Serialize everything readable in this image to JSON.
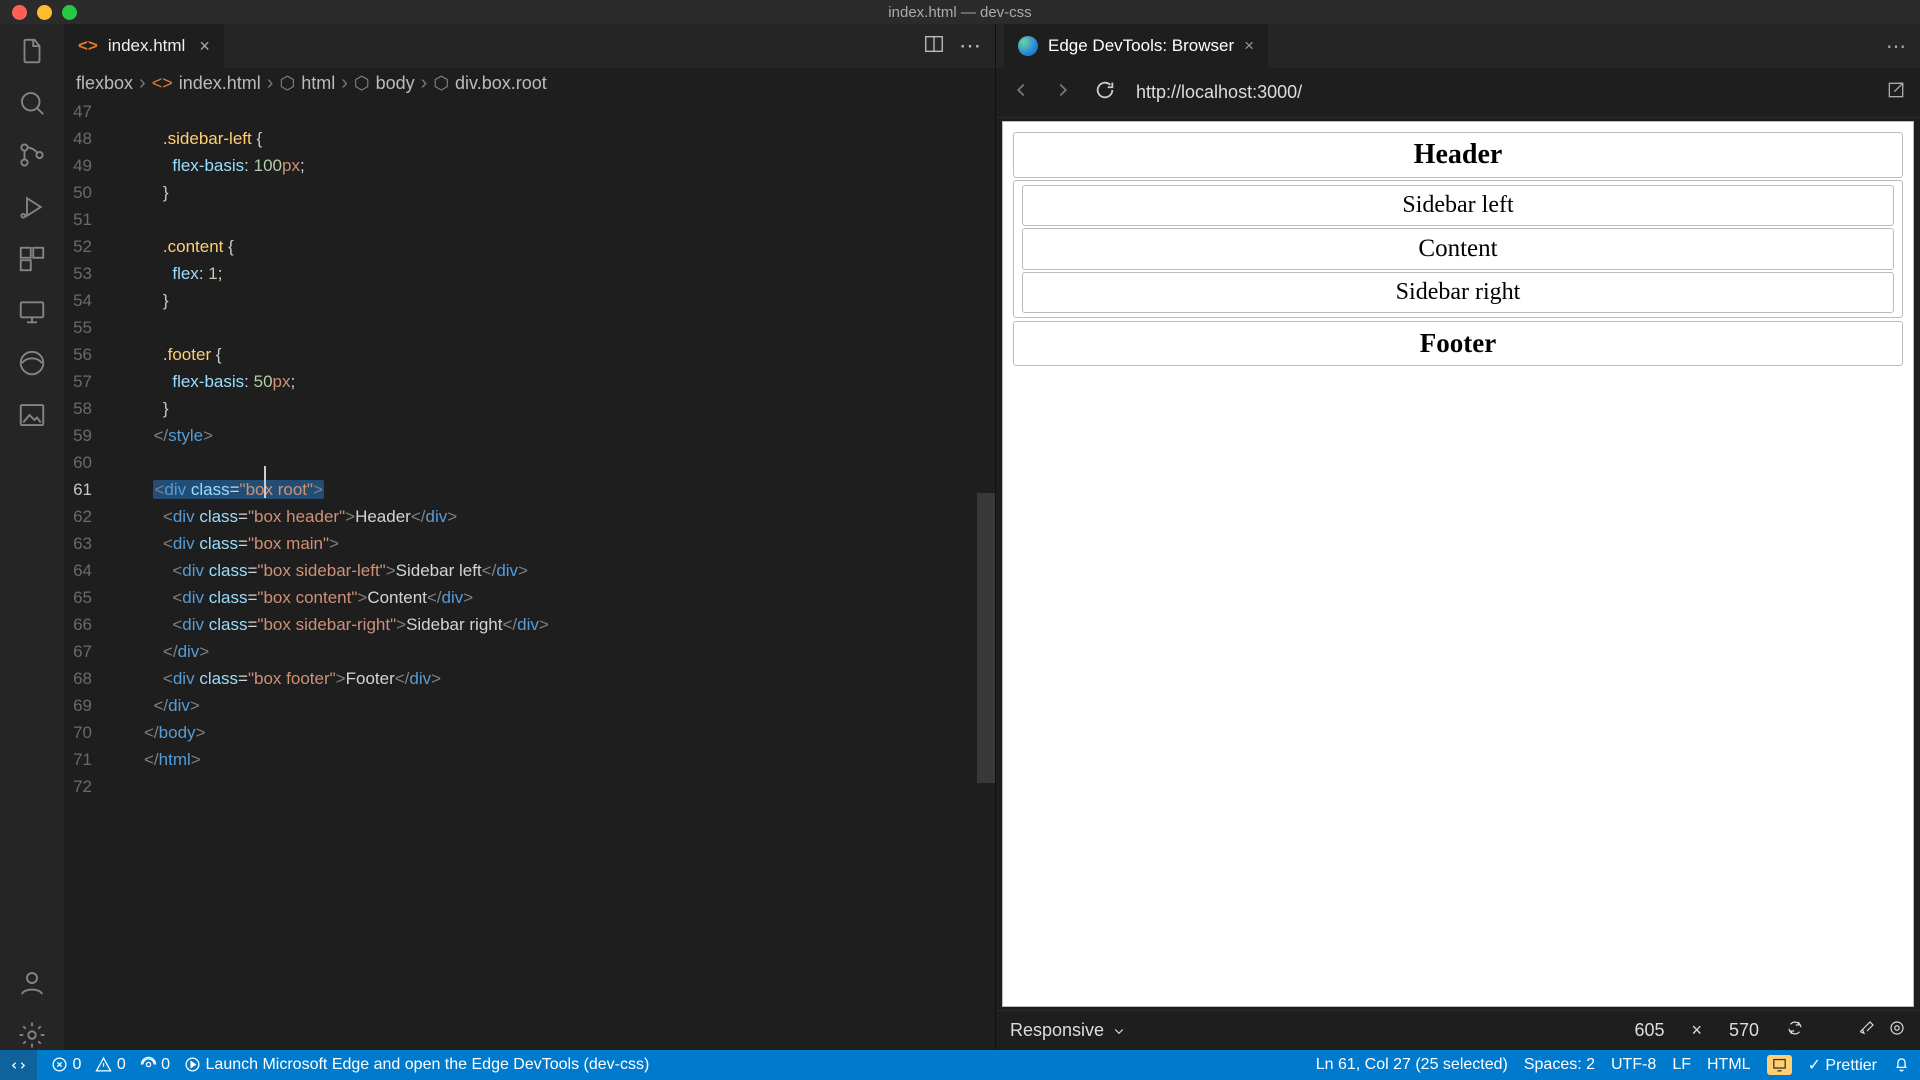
{
  "window": {
    "title": "index.html — dev-css"
  },
  "editor_tab": {
    "label": "index.html"
  },
  "breadcrumbs": [
    "flexbox",
    "index.html",
    "html",
    "body",
    "div.box.root"
  ],
  "code_lines": [
    {
      "n": 47,
      "html": ""
    },
    {
      "n": 48,
      "html": "    <span class='g'>.sidebar-left</span> {"
    },
    {
      "n": 49,
      "html": "      <span class='p'>flex-basis</span><span class='txt'>: </span><span class='v'>100</span><span class='u'>px</span><span class='txt'>;</span>"
    },
    {
      "n": 50,
      "html": "    }"
    },
    {
      "n": 51,
      "html": ""
    },
    {
      "n": 52,
      "html": "    <span class='g'>.content</span> {"
    },
    {
      "n": 53,
      "html": "      <span class='p'>flex</span><span class='txt'>: </span><span class='v'>1</span><span class='txt'>;</span>"
    },
    {
      "n": 54,
      "html": "    }"
    },
    {
      "n": 55,
      "html": ""
    },
    {
      "n": 56,
      "html": "    <span class='g'>.footer</span> {"
    },
    {
      "n": 57,
      "html": "      <span class='p'>flex-basis</span><span class='txt'>: </span><span class='v'>50</span><span class='u'>px</span><span class='txt'>;</span>"
    },
    {
      "n": 58,
      "html": "    }"
    },
    {
      "n": 59,
      "html": "  <span class='k'>&lt;/</span><span class='t'>style</span><span class='k'>&gt;</span>"
    },
    {
      "n": 60,
      "html": ""
    },
    {
      "n": 61,
      "sel": true,
      "html": "  <span class='sel-box'><span class='k'>&lt;</span><span class='t'>div</span> <span class='a'>class</span><span class='txt'>=</span><span class='s'>\"bo<span class='cursor-caret'></span>x root\"</span><span class='k'>&gt;</span></span>"
    },
    {
      "n": 62,
      "html": "    <span class='k'>&lt;</span><span class='t'>div</span> <span class='a'>class</span><span class='txt'>=</span><span class='s'>\"box header\"</span><span class='k'>&gt;</span><span class='txt'>Header</span><span class='k'>&lt;/</span><span class='t'>div</span><span class='k'>&gt;</span>"
    },
    {
      "n": 63,
      "html": "    <span class='k'>&lt;</span><span class='t'>div</span> <span class='a'>class</span><span class='txt'>=</span><span class='s'>\"box main\"</span><span class='k'>&gt;</span>"
    },
    {
      "n": 64,
      "html": "      <span class='k'>&lt;</span><span class='t'>div</span> <span class='a'>class</span><span class='txt'>=</span><span class='s'>\"box sidebar-left\"</span><span class='k'>&gt;</span><span class='txt'>Sidebar left</span><span class='k'>&lt;/</span><span class='t'>div</span><span class='k'>&gt;</span>"
    },
    {
      "n": 65,
      "html": "      <span class='k'>&lt;</span><span class='t'>div</span> <span class='a'>class</span><span class='txt'>=</span><span class='s'>\"box content\"</span><span class='k'>&gt;</span><span class='txt'>Content</span><span class='k'>&lt;/</span><span class='t'>div</span><span class='k'>&gt;</span>"
    },
    {
      "n": 66,
      "html": "      <span class='k'>&lt;</span><span class='t'>div</span> <span class='a'>class</span><span class='txt'>=</span><span class='s'>\"box sidebar-right\"</span><span class='k'>&gt;</span><span class='txt'>Sidebar right</span><span class='k'>&lt;/</span><span class='t'>div</span><span class='k'>&gt;</span>"
    },
    {
      "n": 67,
      "html": "    <span class='k'>&lt;/</span><span class='t'>div</span><span class='k'>&gt;</span>"
    },
    {
      "n": 68,
      "html": "    <span class='k'>&lt;</span><span class='t'>div</span> <span class='a'>class</span><span class='txt'>=</span><span class='s'>\"box footer\"</span><span class='k'>&gt;</span><span class='txt'>Footer</span><span class='k'>&lt;/</span><span class='t'>div</span><span class='k'>&gt;</span>"
    },
    {
      "n": 69,
      "html": "  <span class='k'>&lt;/</span><span class='t'>div</span><span class='k'>&gt;</span>"
    },
    {
      "n": 70,
      "html": "<span class='k'>&lt;/</span><span class='t'>body</span><span class='k'>&gt;</span>"
    },
    {
      "n": 71,
      "html": "<span class='k'>&lt;/</span><span class='t'>html</span><span class='k'>&gt;</span>"
    },
    {
      "n": 72,
      "html": ""
    }
  ],
  "devtools": {
    "title": "Edge DevTools: Browser",
    "url": "http://localhost:3000/",
    "boxes": {
      "header": "Header",
      "sidebar_left": "Sidebar left",
      "content": "Content",
      "sidebar_right": "Sidebar right",
      "footer": "Footer"
    },
    "responsive_label": "Responsive",
    "width": "605",
    "height": "570"
  },
  "status": {
    "errors": "0",
    "warnings": "0",
    "ports": "0",
    "launch": "Launch Microsoft Edge and open the Edge DevTools (dev-css)",
    "cursor": "Ln 61, Col 27 (25 selected)",
    "spaces": "Spaces: 2",
    "encoding": "UTF-8",
    "eol": "LF",
    "lang": "HTML",
    "prettier": "Prettier"
  }
}
